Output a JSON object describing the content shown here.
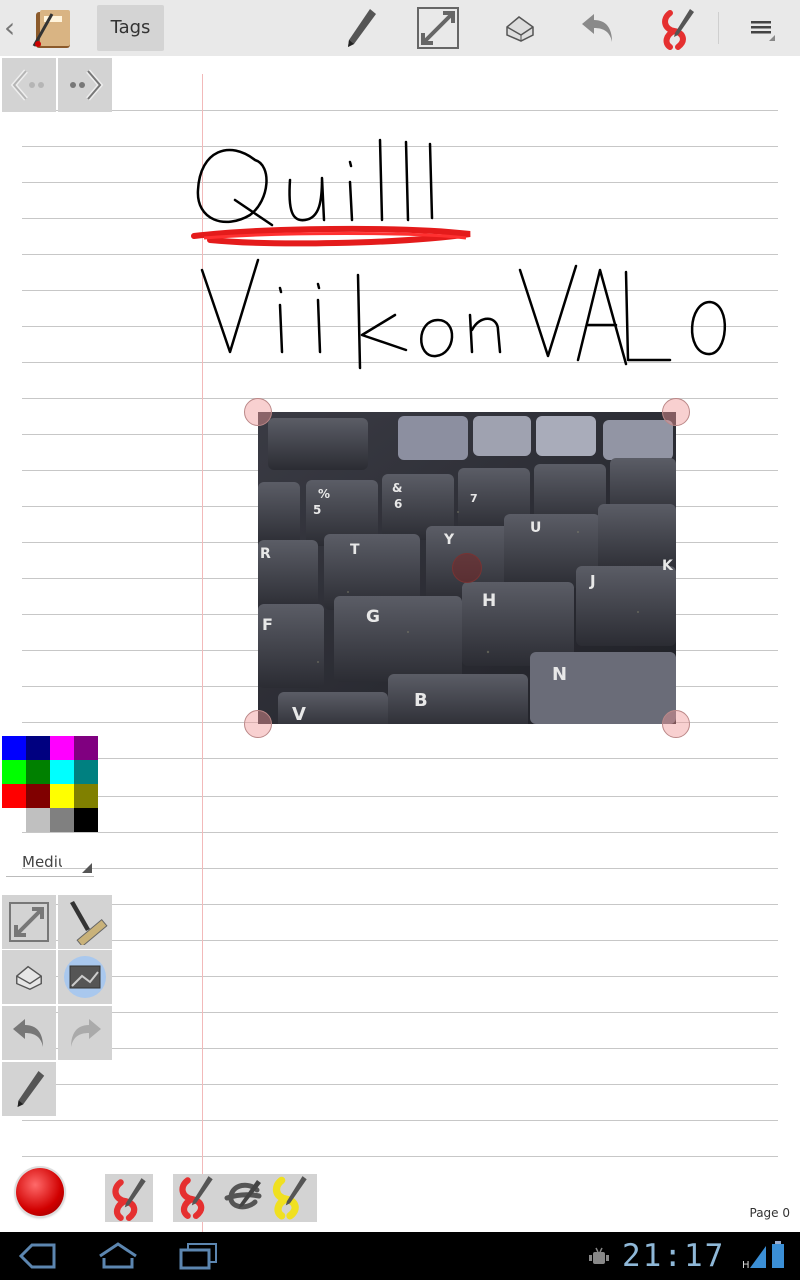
{
  "actionbar": {
    "tags_label": "Tags",
    "icons": [
      "back-icon",
      "notebook-app-icon",
      "pen-icon",
      "resize-icon",
      "eraser-icon",
      "undo-icon",
      "red-pen-icon",
      "overflow-menu-icon"
    ]
  },
  "page": {
    "handwriting_lines": [
      "Quill",
      "Viikon VALO"
    ],
    "label": "Page 0",
    "image_keys_visible": [
      "%",
      "&",
      "T",
      "Y",
      "U",
      "R",
      "G",
      "H",
      "J",
      "F",
      "V",
      "B",
      "N",
      "K",
      "5",
      "6",
      "7"
    ]
  },
  "palette": {
    "colors": [
      "#0000ff",
      "#000080",
      "#ff00ff",
      "#800080",
      "#00ff00",
      "#008000",
      "#00ffff",
      "#008080",
      "#ff0000",
      "#800000",
      "#ffff00",
      "#808000",
      "#ffffff",
      "#c0c0c0",
      "#808080",
      "#000000"
    ]
  },
  "pen_size": {
    "label": "Medium"
  },
  "tools": [
    "fullscreen-icon",
    "ruler-pen-icon",
    "eraser-icon",
    "image-insert-icon",
    "undo-icon",
    "redo-icon",
    "pen-icon"
  ],
  "system_bar": {
    "time": "21:17"
  }
}
